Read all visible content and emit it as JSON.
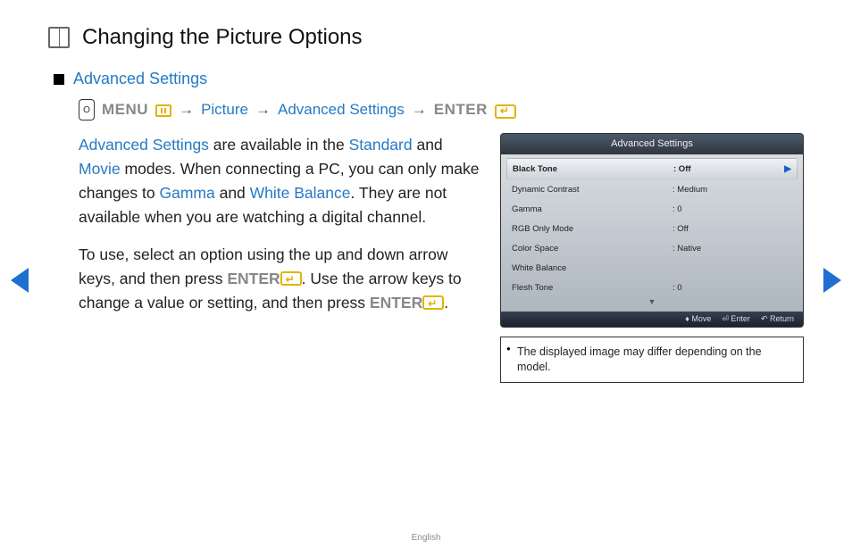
{
  "title": "Changing the Picture Options",
  "section": "Advanced Settings",
  "path": {
    "menu": "MENU",
    "step1": "Picture",
    "step2": "Advanced Settings",
    "enter": "ENTER"
  },
  "body": {
    "p1_a": "Advanced Settings",
    "p1_b": " are available in the ",
    "p1_c": "Standard",
    "p1_d": " and ",
    "p1_e": "Movie",
    "p1_f": " modes. When connecting a PC, you can only make changes to ",
    "p1_g": "Gamma",
    "p1_h": " and ",
    "p1_i": "White Balance",
    "p1_j": ". They are not available when you are watching a digital channel.",
    "p2_a": "To use, select an option using the up and down arrow keys, and then press ",
    "p2_b": "ENTER",
    "p2_c": ". Use the arrow keys to change a value or setting, and then press ",
    "p2_d": "ENTER",
    "p2_e": "."
  },
  "panel": {
    "title": "Advanced Settings",
    "rows": [
      {
        "label": "Black Tone",
        "value": ": Off",
        "selected": true
      },
      {
        "label": "Dynamic Contrast",
        "value": ": Medium",
        "selected": false
      },
      {
        "label": "Gamma",
        "value": ": 0",
        "selected": false
      },
      {
        "label": "RGB Only Mode",
        "value": ": Off",
        "selected": false
      },
      {
        "label": "Color Space",
        "value": ": Native",
        "selected": false
      },
      {
        "label": "White Balance",
        "value": "",
        "selected": false
      },
      {
        "label": "Flesh Tone",
        "value": ": 0",
        "selected": false
      }
    ],
    "footer": {
      "move": "Move",
      "enter": "Enter",
      "return": "Return"
    }
  },
  "note": "The displayed image may differ depending on the model.",
  "footer_lang": "English"
}
